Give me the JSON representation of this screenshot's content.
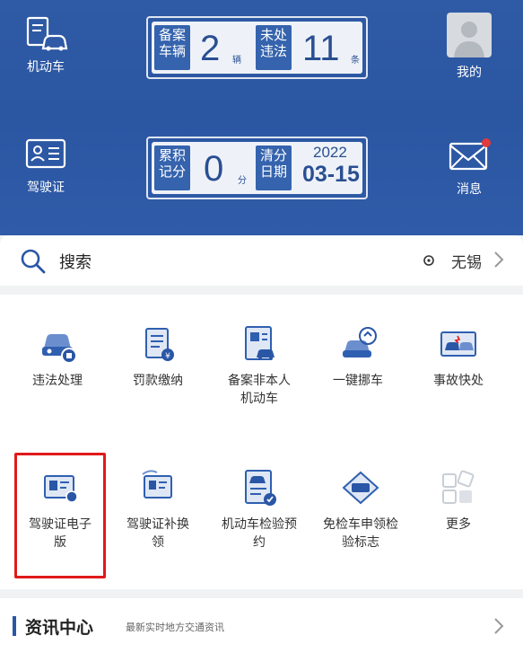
{
  "header": {
    "left_top": {
      "label": "机动车",
      "icon": "vehicle-icon"
    },
    "left_bottom": {
      "label": "驾驶证",
      "icon": "license-card-icon"
    },
    "right_top": {
      "label": "我的",
      "icon": "avatar"
    },
    "right_bottom": {
      "label": "消息",
      "icon": "mail-icon"
    },
    "panel1": {
      "tag1": "备案车辆",
      "count1": "2",
      "unit1": "辆",
      "tag2": "未处违法",
      "count2": "11",
      "unit2": "条"
    },
    "panel2": {
      "tag1": "累积记分",
      "count1": "0",
      "unit1": "分",
      "tag2": "清分日期",
      "year": "2022",
      "date": "03-15"
    }
  },
  "search": {
    "placeholder": "搜索",
    "city": "无锡"
  },
  "services": [
    {
      "label": "违法处理",
      "icon": "car-violation-icon"
    },
    {
      "label": "罚款缴纳",
      "icon": "fine-payment-icon"
    },
    {
      "label": "备案非本人机动车",
      "icon": "register-vehicle-icon"
    },
    {
      "label": "一键挪车",
      "icon": "move-car-icon"
    },
    {
      "label": "事故快处",
      "icon": "accident-icon"
    },
    {
      "label": "驾驶证电子版",
      "icon": "e-license-icon"
    },
    {
      "label": "驾驶证补换领",
      "icon": "license-renew-icon"
    },
    {
      "label": "机动车检验预约",
      "icon": "inspection-booking-icon"
    },
    {
      "label": "免检车申领检验标志",
      "icon": "exempt-sticker-icon"
    },
    {
      "label": "更多",
      "icon": "more-icon"
    }
  ],
  "news": {
    "title": "资讯中心",
    "subtitle": "最新实时地方交通资讯"
  },
  "colors": {
    "header_blue": "#2f5aa5",
    "accent_blue": "#2a56a6",
    "highlight_red": "#e0191b"
  }
}
